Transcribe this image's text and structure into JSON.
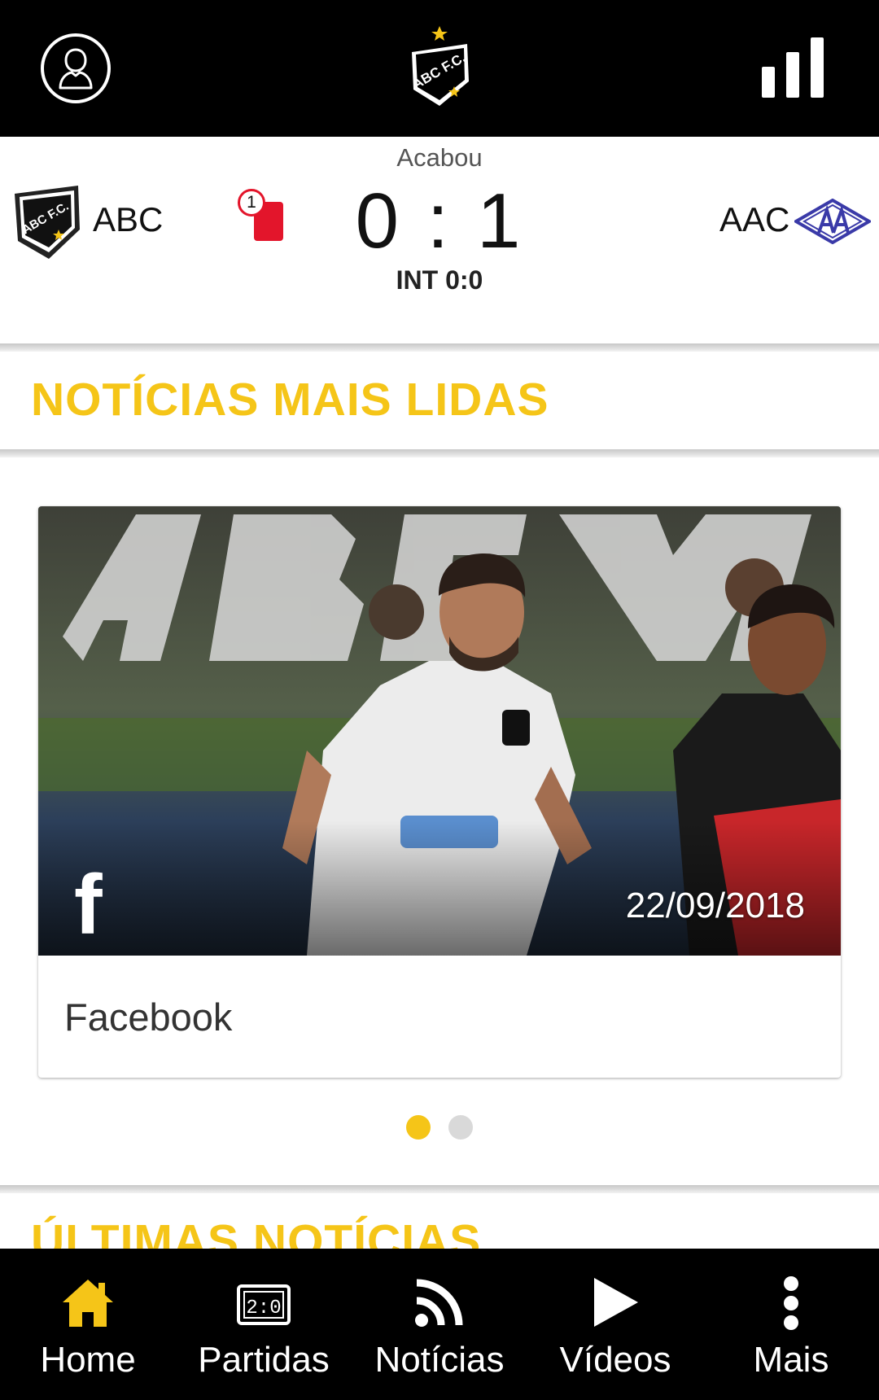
{
  "header": {
    "profile_icon": "user-icon",
    "logo_text": "ABC F.C.",
    "stats_icon": "bar-chart-icon"
  },
  "match": {
    "status": "Acabou",
    "home": {
      "name": "ABC",
      "red_cards": "1"
    },
    "away": {
      "name": "AAC"
    },
    "score": "0 : 1",
    "halftime": "INT 0:0"
  },
  "sections": {
    "most_read": "NOTÍCIAS MAIS LIDAS",
    "latest": "ÚLTIMAS NOTÍCIAS"
  },
  "news_card": {
    "social_icon": "facebook-icon",
    "date": "22/09/2018",
    "source": "Facebook"
  },
  "carousel": {
    "active_index": 0,
    "count": 2
  },
  "nav": [
    {
      "label": "Home",
      "icon": "home-icon",
      "active": true
    },
    {
      "label": "Partidas",
      "icon": "scoreboard-icon"
    },
    {
      "label": "Notícias",
      "icon": "rss-icon"
    },
    {
      "label": "Vídeos",
      "icon": "play-icon"
    },
    {
      "label": "Mais",
      "icon": "more-vertical-icon"
    }
  ],
  "colors": {
    "accent": "#f5c518",
    "red_card": "#e3152b",
    "bar": "#000000",
    "away_crest": "#3a3aa8"
  }
}
